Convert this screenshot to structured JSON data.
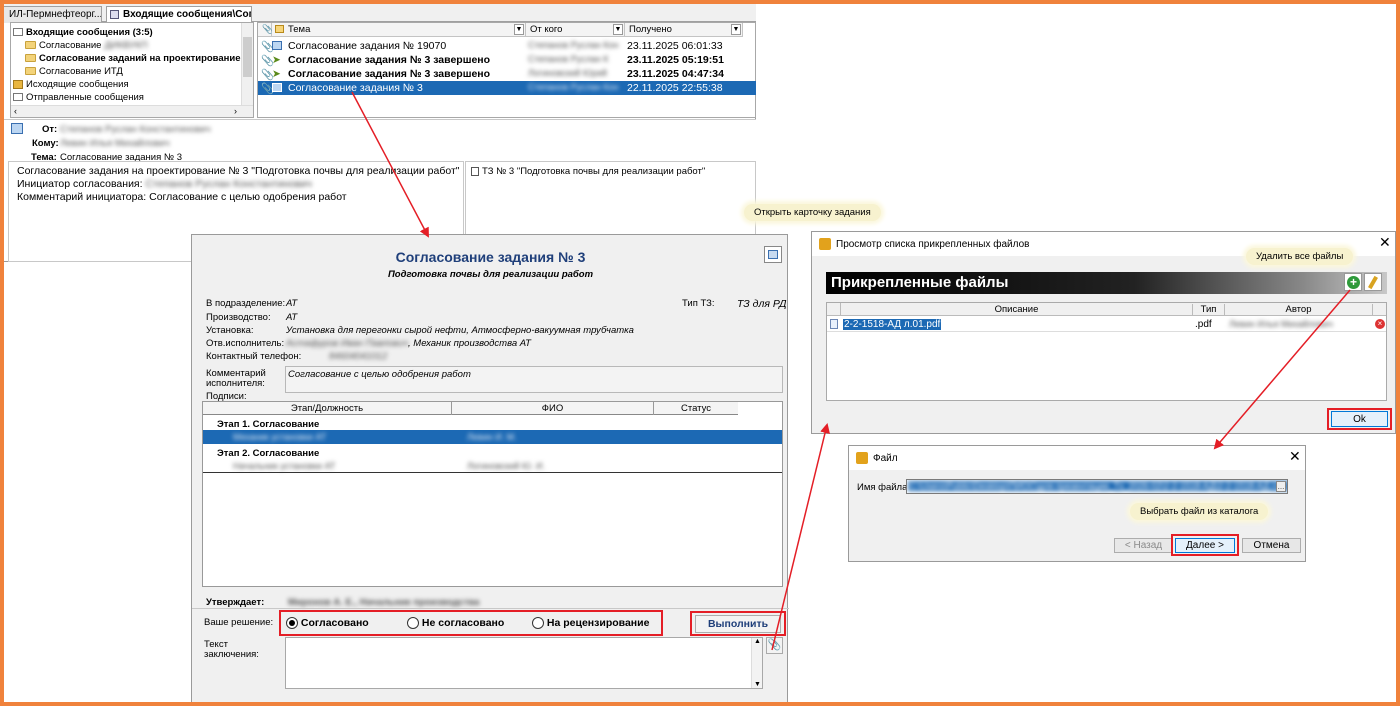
{
  "tabs": [
    {
      "label": "ИЛ-Пермнефтеорг..."
    },
    {
      "label": "Входящие сообщения\\Согла..."
    }
  ],
  "tree": {
    "root": "Входящие сообщения (3:5)",
    "items": [
      {
        "label": "Согласование",
        "suffix": "ДИКВУКП"
      },
      {
        "label": "Согласование заданий на проектирование ("
      },
      {
        "label": "Согласование ИТД"
      }
    ],
    "outgoing": "Исходящие сообщения",
    "sent": "Отправленные сообщения"
  },
  "messages": {
    "headers": {
      "subject": "Тема",
      "from": "От кого",
      "received": "Получено"
    },
    "rows": [
      {
        "subject": "Согласование задания № 19070",
        "from": "Степанов Руслан Кон",
        "received": "23.11.2025 06:01:33"
      },
      {
        "subject": "Согласование задания № 3 завершено",
        "from": "Степанов Руслан К",
        "received": "23.11.2025 05:19:51"
      },
      {
        "subject": "Согласование задания № 3 завершено",
        "from": "Логиновский Юрий",
        "received": "23.11.2025 04:47:34"
      },
      {
        "subject": "Согласование задания № 3",
        "from": "Степанов Руслан Кон",
        "received": "22.11.2025 22:55:38"
      }
    ]
  },
  "preview": {
    "from_label": "От:",
    "from_value": "Степанов Руслан Константинович",
    "to_label": "Кому:",
    "to_value": "Левин Илья Михайлович",
    "subject_label": "Тема:",
    "subject_value": "Согласование задания № 3",
    "body_line1": "Согласование задания на проектирование № 3 \"Подготовка почвы для реализации работ\"",
    "body_line2_label": "Инициатор согласования:",
    "body_line2_value": "Степанов Руслан Константинович",
    "body_line3": "Комментарий инициатора: Согласование с целью одобрения работ",
    "attachment": "ТЗ № 3 \"Подготовка почвы для реализации работ\""
  },
  "card": {
    "title": "Согласование задания № 3",
    "subtitle": "Подготовка почвы для реализации работ",
    "fields": {
      "dept_label": "В подразделение:",
      "dept_value": "АТ",
      "prod_label": "Производство:",
      "prod_value": "АТ",
      "unit_label": "Установка:",
      "unit_value": "Установка для перегонки сырой нефти, Атмосферно-вакуумная трубчатка",
      "exec_label": "Отв.исполнитель:",
      "exec_value": "Астафуров Иван Павлович",
      "exec_suffix": ", Механик производства АТ",
      "phone_label": "Контактный телефон:",
      "phone_value": "84604041012",
      "tz_type_label": "Тип ТЗ:",
      "tz_type_value": "ТЗ для РД",
      "comment_label1": "Комментарий",
      "comment_label2": "исполнителя:",
      "comment_value": "Согласование с целью одобрения работ",
      "signatures_label": "Подписи:"
    },
    "sig_headers": {
      "stage": "Этап/Должность",
      "name": "ФИО",
      "status": "Статус"
    },
    "stage1": "Этап 1. Согласование",
    "stage1_role": "Механик установки АТ",
    "stage1_name": "Левин И. М.",
    "stage2": "Этап 2. Согласование",
    "stage2_role": "Начальник установки АТ",
    "stage2_name": "Логиновский Ю. И.",
    "approver_label": "Утверждает:",
    "approver_value": "Миронов А. Е., Начальник производства",
    "decision_label": "Ваше решение:",
    "decision_options": [
      "Согласовано",
      "Не согласовано",
      "На рецензирование"
    ],
    "execute_label": "Выполнить",
    "conclusion_label1": "Текст",
    "conclusion_label2": "заключения:"
  },
  "callouts": {
    "open_card": "Открыть карточку задания",
    "delete_all": "Удалить все файлы",
    "choose_file": "Выбрать файл из каталога"
  },
  "attachments_window": {
    "title": "Просмотр списка прикрепленных файлов",
    "header": "Прикрепленные файлы",
    "columns": {
      "desc": "Описание",
      "type": "Тип",
      "author": "Автор"
    },
    "file": {
      "desc": "2-2-1518-АД л.01.pdf",
      "type": ".pdf",
      "author": "Левин Илья Михайлович"
    },
    "ok_label": "Ok"
  },
  "file_window": {
    "title": "Файл",
    "filename_label": "Имя файла:",
    "filename_value": "C:\\Users\\Public\\Desktop\\ПИОС\\для презентации_Тз_2026-02\\2-2-1518-АД\\2-2-1518-АД л.01",
    "back_label": "< Назад",
    "next_label": "Далее >",
    "cancel_label": "Отмена"
  },
  "colors": {
    "frame": "#f0823c",
    "selection": "#1c69b4",
    "highlight": "#e41e26",
    "callout": "#f7f2cf"
  }
}
